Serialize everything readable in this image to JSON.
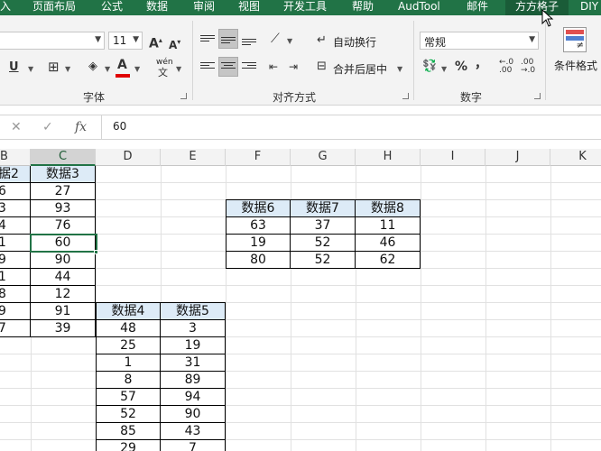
{
  "ribbon_tabs": [
    {
      "label": "入"
    },
    {
      "label": "页面布局"
    },
    {
      "label": "公式"
    },
    {
      "label": "数据"
    },
    {
      "label": "审阅"
    },
    {
      "label": "视图"
    },
    {
      "label": "开发工具"
    },
    {
      "label": "帮助"
    },
    {
      "label": "AudTool"
    },
    {
      "label": "邮件"
    },
    {
      "label": "方方格子"
    },
    {
      "label": "DIY"
    }
  ],
  "font_group": {
    "font_size": "11",
    "label": "字体",
    "phonetic_label": "wén"
  },
  "align_group": {
    "wrap_text": "自动换行",
    "merge_center": "合并后居中",
    "label": "对齐方式"
  },
  "number_group": {
    "format": "常规",
    "percent": "%",
    "comma": "，",
    "label": "数字"
  },
  "styles_group": {
    "conditional_format": "条件格式"
  },
  "formula_bar": {
    "fx": "fx",
    "value": "60"
  },
  "columns": [
    "B",
    "C",
    "D",
    "E",
    "F",
    "G",
    "H",
    "I",
    "J",
    "K"
  ],
  "table1": {
    "headers": [
      "据2",
      "数据3"
    ],
    "rows": [
      [
        "6",
        "27"
      ],
      [
        "3",
        "93"
      ],
      [
        "4",
        "76"
      ],
      [
        "1",
        "60"
      ],
      [
        "9",
        "90"
      ],
      [
        "1",
        "44"
      ],
      [
        "8",
        "12"
      ],
      [
        "9",
        "91"
      ],
      [
        "7",
        "39"
      ]
    ]
  },
  "table2": {
    "headers": [
      "数据6",
      "数据7",
      "数据8"
    ],
    "rows": [
      [
        "63",
        "37",
        "11"
      ],
      [
        "19",
        "52",
        "46"
      ],
      [
        "80",
        "52",
        "62"
      ]
    ]
  },
  "table3": {
    "headers": [
      "数据4",
      "数据5"
    ],
    "rows": [
      [
        "48",
        "3"
      ],
      [
        "25",
        "19"
      ],
      [
        "1",
        "31"
      ],
      [
        "8",
        "89"
      ],
      [
        "57",
        "94"
      ],
      [
        "52",
        "90"
      ],
      [
        "85",
        "43"
      ],
      [
        "29",
        "7"
      ]
    ]
  },
  "colors": {
    "ribbon_green": "#217346",
    "header_fill": "#ddebf7",
    "font_color_red": "#e00000"
  }
}
